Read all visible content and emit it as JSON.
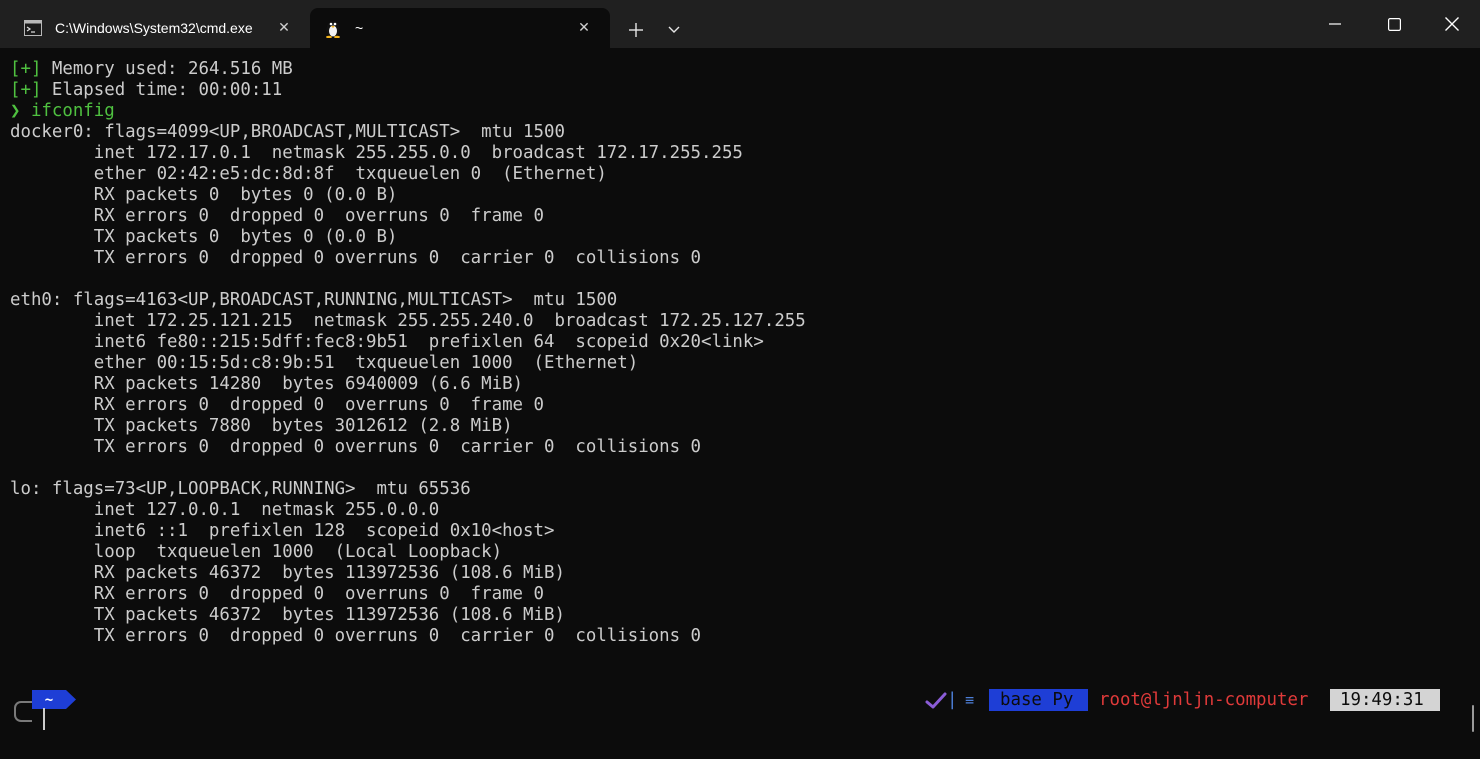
{
  "tabs": [
    {
      "title": "C:\\Windows\\System32\\cmd.exe",
      "icon": "cmd-icon",
      "active": false
    },
    {
      "title": "~",
      "icon": "linux-penguin-icon",
      "active": true
    }
  ],
  "terminal": {
    "lines": [
      {
        "prefix": "[+]",
        "text": " Memory used: 264.516 MB"
      },
      {
        "prefix": "[+]",
        "text": " Elapsed time: 00:00:11"
      },
      {
        "prefix": "❯",
        "text": " ifconfig",
        "green_text": true
      },
      {
        "text": "docker0: flags=4099<UP,BROADCAST,MULTICAST>  mtu 1500"
      },
      {
        "text": "        inet 172.17.0.1  netmask 255.255.0.0  broadcast 172.17.255.255"
      },
      {
        "text": "        ether 02:42:e5:dc:8d:8f  txqueuelen 0  (Ethernet)"
      },
      {
        "text": "        RX packets 0  bytes 0 (0.0 B)"
      },
      {
        "text": "        RX errors 0  dropped 0  overruns 0  frame 0"
      },
      {
        "text": "        TX packets 0  bytes 0 (0.0 B)"
      },
      {
        "text": "        TX errors 0  dropped 0 overruns 0  carrier 0  collisions 0"
      },
      {
        "text": ""
      },
      {
        "text": "eth0: flags=4163<UP,BROADCAST,RUNNING,MULTICAST>  mtu 1500"
      },
      {
        "text": "        inet 172.25.121.215  netmask 255.255.240.0  broadcast 172.25.127.255"
      },
      {
        "text": "        inet6 fe80::215:5dff:fec8:9b51  prefixlen 64  scopeid 0x20<link>"
      },
      {
        "text": "        ether 00:15:5d:c8:9b:51  txqueuelen 1000  (Ethernet)"
      },
      {
        "text": "        RX packets 14280  bytes 6940009 (6.6 MiB)"
      },
      {
        "text": "        RX errors 0  dropped 0  overruns 0  frame 0"
      },
      {
        "text": "        TX packets 7880  bytes 3012612 (2.8 MiB)"
      },
      {
        "text": "        TX errors 0  dropped 0 overruns 0  carrier 0  collisions 0"
      },
      {
        "text": ""
      },
      {
        "text": "lo: flags=73<UP,LOOPBACK,RUNNING>  mtu 65536"
      },
      {
        "text": "        inet 127.0.0.1  netmask 255.0.0.0"
      },
      {
        "text": "        inet6 ::1  prefixlen 128  scopeid 0x10<host>"
      },
      {
        "text": "        loop  txqueuelen 1000  (Local Loopback)"
      },
      {
        "text": "        RX packets 46372  bytes 113972536 (108.6 MiB)"
      },
      {
        "text": "        RX errors 0  dropped 0  overruns 0  frame 0"
      },
      {
        "text": "        TX packets 46372  bytes 113972536 (108.6 MiB)"
      },
      {
        "text": "        TX errors 0  dropped 0 overruns 0  carrier 0  collisions 0"
      }
    ]
  },
  "prompt": {
    "directory": "~",
    "status_icon": "check-icon",
    "separator": "|",
    "menu_glyph": "≡",
    "env": "base Py",
    "user_host": "root@ljnljn-computer",
    "time": "19:49:31"
  },
  "colors": {
    "background": "#0c0c0c",
    "tabbar": "#202020",
    "green": "#4fc140",
    "env_badge": "#1e3ed6",
    "user_host": "#e03a3a",
    "clock_bg": "#d4d4d4",
    "check": "#8a5cd6"
  }
}
